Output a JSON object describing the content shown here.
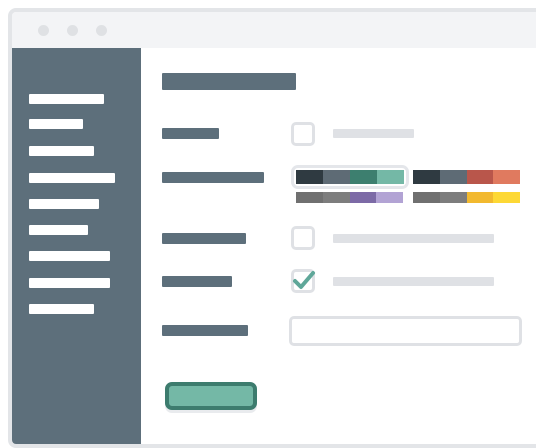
{
  "window": {
    "controls": [
      "close-dot",
      "minimize-dot",
      "maximize-dot"
    ],
    "control_color": "#dfe1e4"
  },
  "sidebar": {
    "background": "#5d6f7b",
    "item_count": 9
  },
  "form": {
    "text_color": "#5d6f7b",
    "placeholder_color": "#dfe1e5",
    "rows": [
      {
        "control": "checkbox",
        "checked": false
      },
      {
        "control": "color-theme-picker",
        "selected_theme": 0
      },
      {
        "control": "checkbox",
        "checked": false
      },
      {
        "control": "checkbox",
        "checked": true
      },
      {
        "control": "text-input",
        "value": ""
      }
    ],
    "themes": [
      {
        "colors": [
          "#2f3a41",
          "#5e6b75",
          "#3d7f6f",
          "#74b8a6"
        ]
      },
      {
        "colors": [
          "#2f3a41",
          "#5e6b75",
          "#b9564b",
          "#e07a5f"
        ]
      },
      {
        "colors": [
          "#707070",
          "#7d7d7d",
          "#7c6aa6",
          "#b2a3d4"
        ]
      },
      {
        "colors": [
          "#707070",
          "#7d7d7d",
          "#f2b92f",
          "#fdd835"
        ]
      }
    ],
    "checkmark_color": "#5fa799",
    "submit": {
      "fill": "#74b8a6",
      "border": "#3d7c6e"
    }
  }
}
